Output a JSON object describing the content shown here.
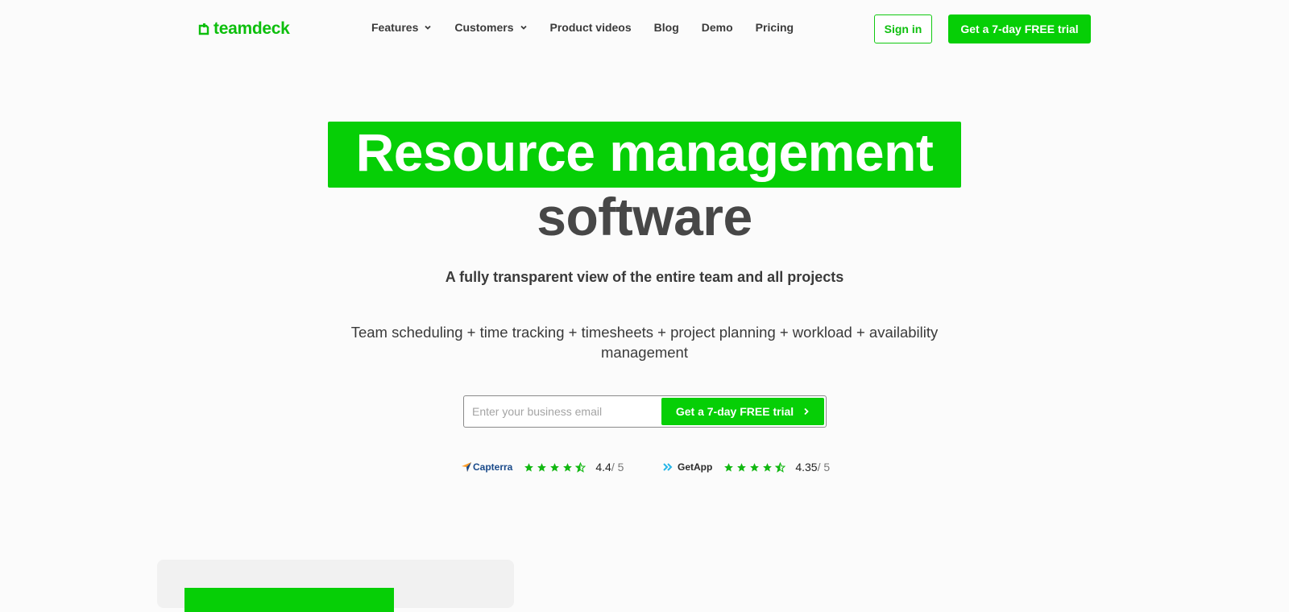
{
  "nav": {
    "logo_text": "teamdeck",
    "items": [
      {
        "label": "Features",
        "dropdown": true
      },
      {
        "label": "Customers",
        "dropdown": true
      },
      {
        "label": "Product videos",
        "dropdown": false
      },
      {
        "label": "Blog",
        "dropdown": false
      },
      {
        "label": "Demo",
        "dropdown": false
      },
      {
        "label": "Pricing",
        "dropdown": false
      }
    ],
    "sign_in": "Sign in",
    "trial_cta": "Get a 7-day FREE trial"
  },
  "hero": {
    "title_highlight": "Resource management",
    "title_rest": "software",
    "subtitle": "A fully transparent view of the entire team and all projects",
    "features": "Team scheduling + time tracking + timesheets + project planning + workload + availability management"
  },
  "form": {
    "email_placeholder": "Enter your business email",
    "trial_cta": "Get a 7-day FREE trial"
  },
  "ratings": [
    {
      "brand": "Capterra",
      "score": "4.4",
      "scale": " / 5",
      "stars": 4.5
    },
    {
      "brand": "GetApp",
      "score": "4.35",
      "scale": " / 5",
      "stars": 4.5
    }
  ],
  "colors": {
    "brand_green": "#06cf06",
    "text_dark": "#3a3a3a",
    "capterra_blue": "#1a4a8a"
  }
}
